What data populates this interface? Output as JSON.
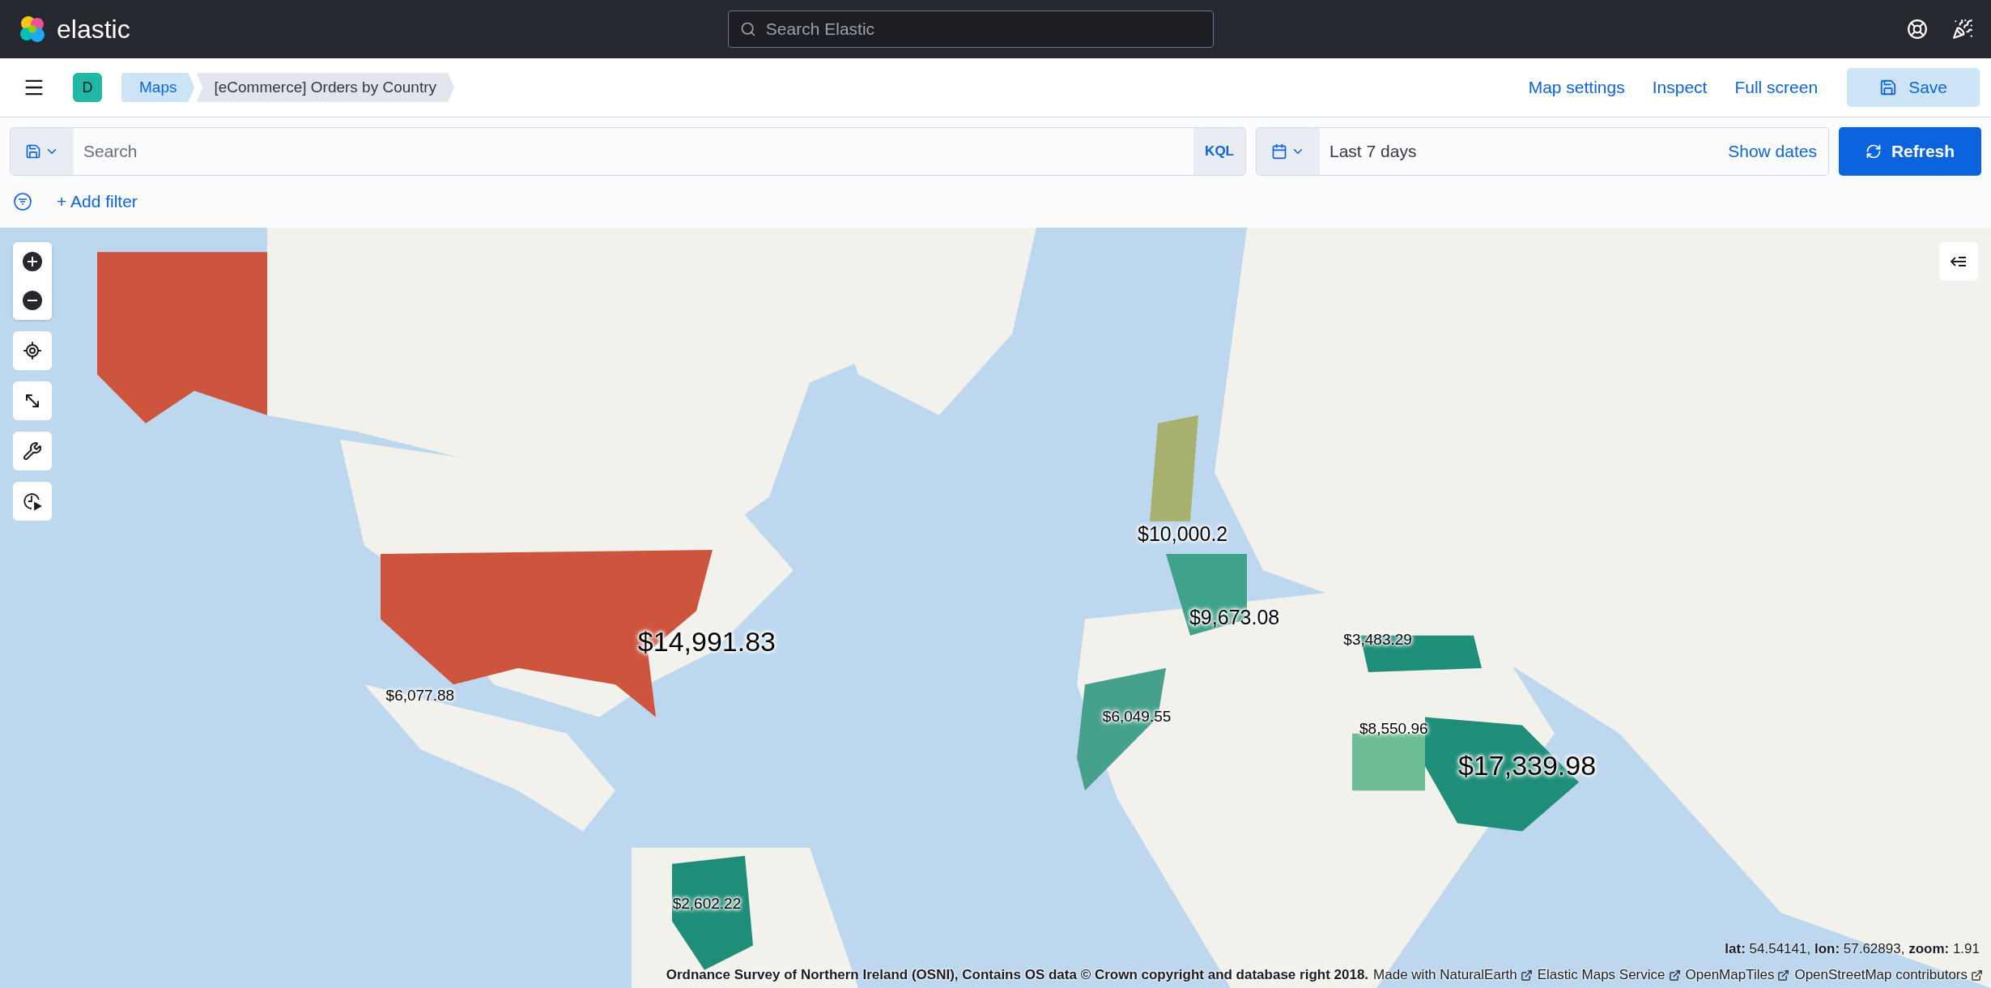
{
  "header": {
    "logo": "elastic",
    "search_placeholder": "Search Elastic"
  },
  "nav": {
    "space_avatar": "D",
    "breadcrumbs": [
      {
        "label": "Maps",
        "selected": false
      },
      {
        "label": "[eCommerce] Orders by Country",
        "selected": true
      }
    ],
    "actions": [
      "Map settings",
      "Inspect",
      "Full screen"
    ],
    "save": "Save"
  },
  "query": {
    "placeholder": "Search",
    "language": "KQL",
    "time": "Last 7 days",
    "show_dates": "Show dates",
    "refresh": "Refresh"
  },
  "filters": {
    "add": "+ Add filter"
  },
  "map": {
    "labels": [
      {
        "text": "$14,991.83",
        "kind": "large"
      },
      {
        "text": "$6,077.88",
        "kind": "small"
      },
      {
        "text": "$10,000.2",
        "kind": "medium"
      },
      {
        "text": "$9,673.08",
        "kind": "medium"
      },
      {
        "text": "$3,483.29",
        "kind": "small"
      },
      {
        "text": "$6,049.55",
        "kind": "small"
      },
      {
        "text": "$8,550.96",
        "kind": "small"
      },
      {
        "text": "$17,339.98",
        "kind": "large"
      },
      {
        "text": "$2,602.22",
        "kind": "small"
      }
    ],
    "coordinates": "**lat:** 54.54141, **lon:** 57.62893, **zoom:** 1.91",
    "attribution": {
      "text": "Ordnance Survey of Northern Ireland (OSNI), Contains OS data © Crown copyright and database right 2018.",
      "links": [
        "Made with NaturalEarth",
        "Elastic Maps Service",
        "OpenMapTiles",
        "OpenStreetMap contributors"
      ]
    }
  }
}
